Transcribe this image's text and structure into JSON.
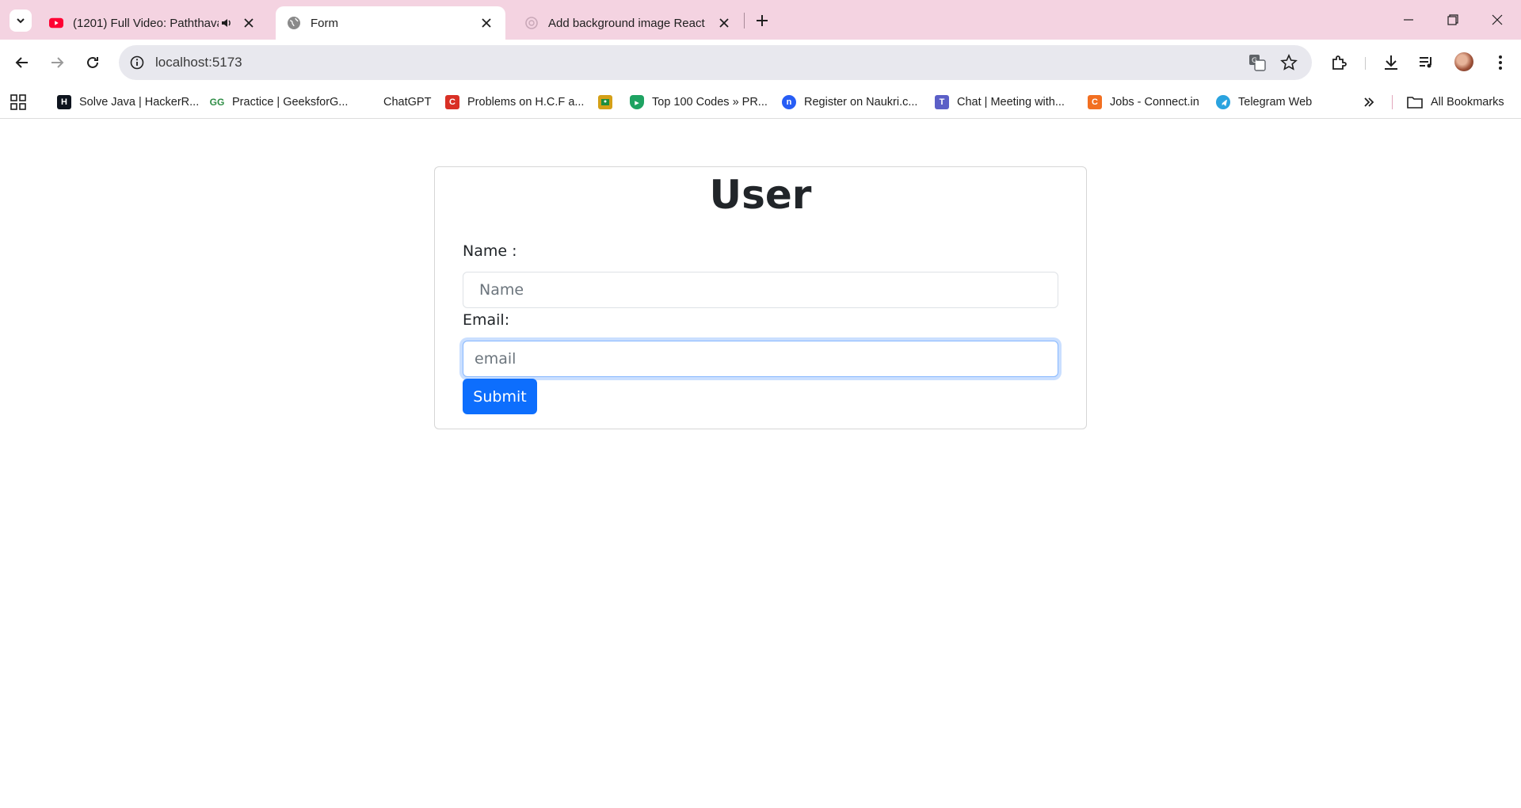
{
  "browser": {
    "tabs": [
      {
        "title": "(1201) Full Video: Paththava",
        "favicon": "youtube-icon",
        "audio": true,
        "active": false
      },
      {
        "title": "Form",
        "favicon": "globe-icon",
        "active": true
      },
      {
        "title": "Add background image React",
        "favicon": "openai-icon",
        "active": false
      }
    ],
    "address": "localhost:5173",
    "bookmarks": [
      {
        "label": "Solve Java | HackerR...",
        "icon": "hackerrank-icon",
        "color": "#0e141e"
      },
      {
        "label": "Practice | GeeksforG...",
        "icon": "geeksforgeeks-icon",
        "color": "#2f8d46"
      },
      {
        "label": "ChatGPT",
        "icon": "chatgpt-icon",
        "color": ""
      },
      {
        "label": "Problems on H.C.F a...",
        "icon": "problems-icon",
        "color": "#d93025"
      },
      {
        "label": "",
        "icon": "classroom-icon",
        "color": "#d4a017"
      },
      {
        "label": "Top 100 Codes » PR...",
        "icon": "prepinsta-icon",
        "color": "#1ea362"
      },
      {
        "label": "Register on Naukri.c...",
        "icon": "naukri-icon",
        "color": "#275df5"
      },
      {
        "label": "Chat | Meeting with...",
        "icon": "teams-icon",
        "color": "#5b5fc7"
      },
      {
        "label": "Jobs - Connect.in",
        "icon": "connect-icon",
        "color": "#f26f21"
      },
      {
        "label": "Telegram Web",
        "icon": "telegram-icon",
        "color": "#2aa3df"
      }
    ],
    "all_bookmarks_label": "All Bookmarks"
  },
  "form": {
    "heading": "User",
    "name_label": "Name :",
    "name_placeholder": "Name",
    "email_label": "Email:",
    "email_placeholder": "email",
    "submit_label": "Submit"
  },
  "colors": {
    "tabstrip": "#f4d3e1",
    "primary": "#0d6efd"
  }
}
